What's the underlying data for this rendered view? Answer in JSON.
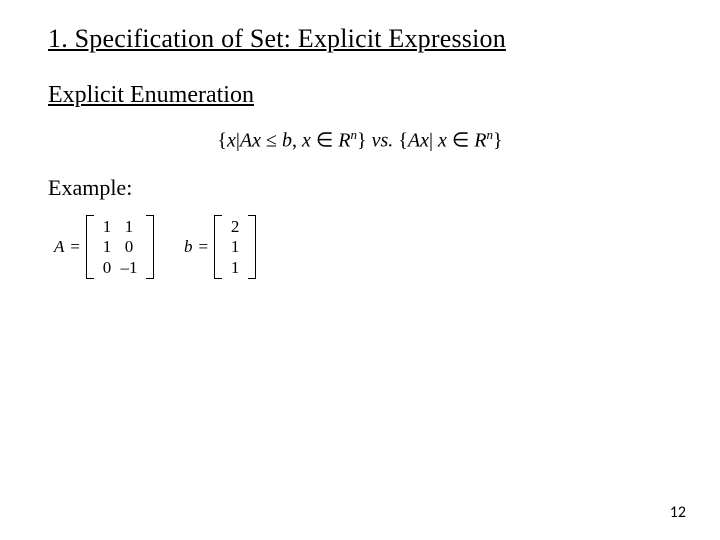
{
  "title": "1. Specification of Set: Explicit Expression",
  "subhead": "Explicit Enumeration",
  "formula": {
    "lbrace1": "{",
    "x1": "x",
    "bar1": "|",
    "Ax": "Ax",
    "le": " ≤ ",
    "b": "b",
    "comma": ", ",
    "x2": "x",
    "in1": " ∈ ",
    "R1": "R",
    "n1": "n",
    "rbrace1": "}",
    "vs": " vs. ",
    "lbrace2": "{",
    "Ax2": "Ax",
    "bar2": "| ",
    "x3": "x",
    "in2": " ∈ ",
    "R2": "R",
    "n2": "n",
    "rbrace2": "}"
  },
  "example_label": "Example:",
  "A": {
    "name": "A",
    "eq": " = ",
    "rows": [
      [
        "1",
        "1"
      ],
      [
        "1",
        "0"
      ],
      [
        "0",
        "–1"
      ]
    ]
  },
  "bvec": {
    "name": "b",
    "eq": " = ",
    "rows": [
      [
        "2"
      ],
      [
        "1"
      ],
      [
        "1"
      ]
    ]
  },
  "page_number": "12"
}
